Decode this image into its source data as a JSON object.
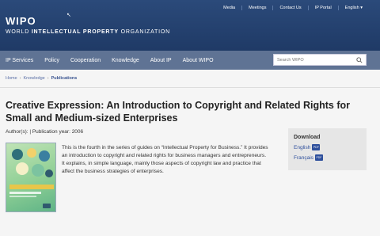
{
  "header": {
    "top_links": [
      "Media",
      "Meetings",
      "Contact Us",
      "IP Portal",
      "English ▾"
    ],
    "logo_mark": "WIPO",
    "logo_text_1": "WORLD ",
    "logo_text_bold": "INTELLECTUAL PROPERTY",
    "logo_text_2": " ORGANIZATION"
  },
  "nav": {
    "items": [
      "IP Services",
      "Policy",
      "Cooperation",
      "Knowledge",
      "About IP",
      "About WIPO"
    ],
    "search_placeholder": "Search WIPO"
  },
  "breadcrumb": {
    "items": [
      "Home",
      "Knowledge"
    ],
    "current": "Publications",
    "separator": "›"
  },
  "publication": {
    "title": "Creative Expression: An Introduction to Copyright and Related Rights for Small and Medium-sized Enterprises",
    "meta": "Author(s): | Publication year: 2006",
    "description": "This is the fourth in the series of guides on “Intellectual Property for Business.” It provides an introduction to copyright and related rights for business managers and entrepreneurs. It explains, in simple language, mainly those aspects of copyright law and practice that affect the business strategies of enterprises."
  },
  "download": {
    "title": "Download",
    "links": [
      {
        "label": "English",
        "badge": "PDF"
      },
      {
        "label": "Français",
        "badge": "PDF"
      }
    ]
  },
  "colors": {
    "header_bg": "#1f3a66",
    "nav_bg": "#5f7394",
    "link": "#2e4f9c"
  }
}
